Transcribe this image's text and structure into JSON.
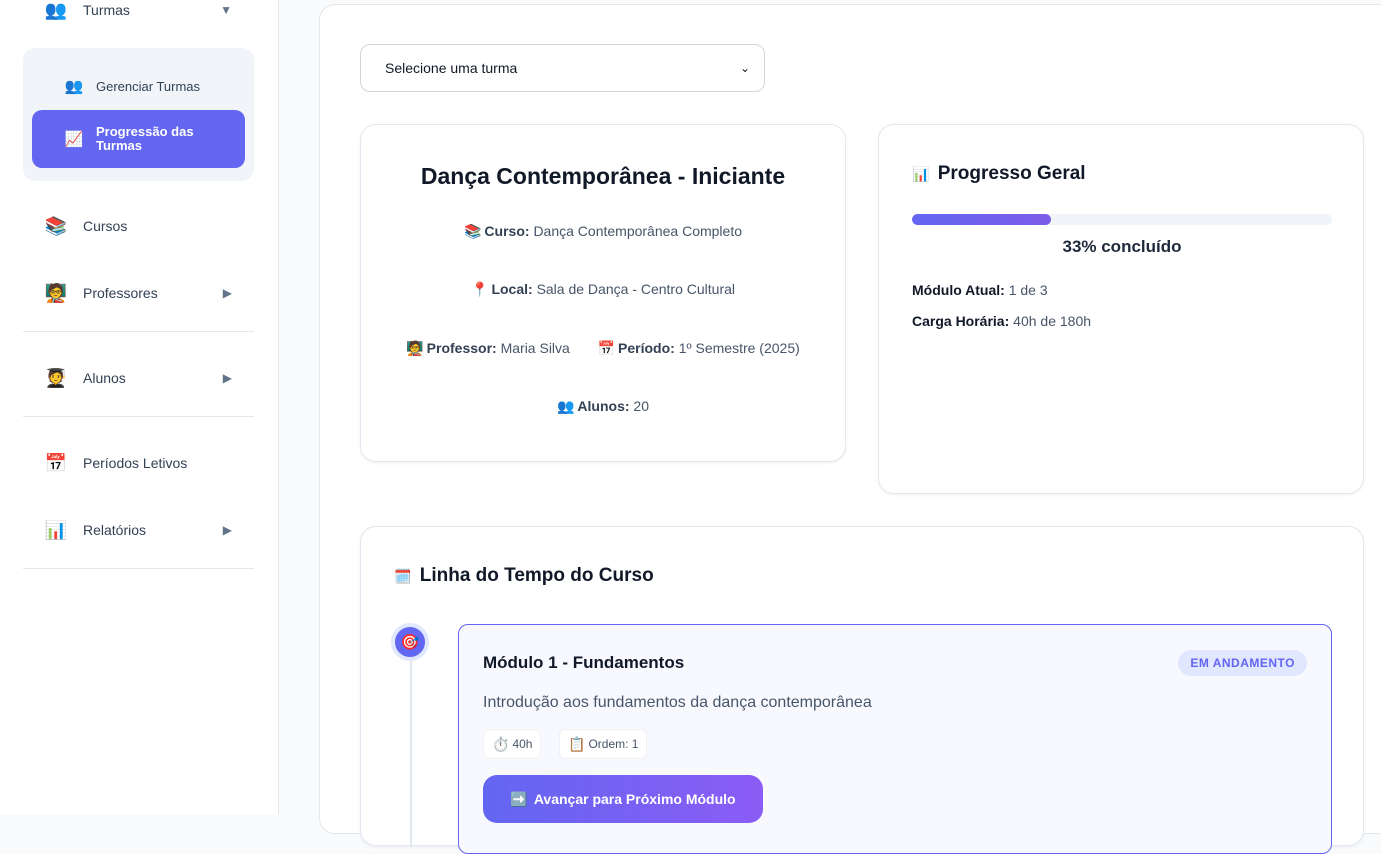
{
  "sidebar": {
    "turmas": {
      "label": "Turmas",
      "icon": "people-icon"
    },
    "submenu": [
      {
        "label": "Gerenciar Turmas",
        "icon": "people-icon"
      },
      {
        "label": "Progressão das Turmas",
        "icon": "chart-increasing-icon",
        "active": true
      }
    ],
    "items": [
      {
        "label": "Cursos",
        "icon": "books-icon"
      },
      {
        "label": "Professores",
        "icon": "teacher-icon"
      },
      {
        "label": "Alunos",
        "icon": "student-icon"
      },
      {
        "label": "Períodos Letivos",
        "icon": "calendar-icon"
      },
      {
        "label": "Relatórios",
        "icon": "bar-chart-icon"
      }
    ],
    "accent_color": "#6366f1"
  },
  "select": {
    "value": "Selecione uma turma"
  },
  "turma": {
    "title": "Dança Contemporânea - Iniciante",
    "curso_label": "Curso:",
    "curso_value": "Dança Contemporânea Completo",
    "local_label": "Local:",
    "local_value": "Sala de Dança - Centro Cultural",
    "professor_label": "Professor:",
    "professor_value": "Maria Silva",
    "periodo_label": "Período:",
    "periodo_value": "1º Semestre (2025)",
    "alunos_label": "Alunos:",
    "alunos_value": "20"
  },
  "progresso": {
    "title": "Progresso Geral",
    "percent": 33,
    "percent_text": "33% concluído",
    "modulo_label": "Módulo Atual:",
    "modulo_value": "1 de 3",
    "carga_label": "Carga Horária:",
    "carga_value": "40h de 180h"
  },
  "timeline": {
    "title": "Linha do Tempo do Curso",
    "module": {
      "title": "Módulo 1 - Fundamentos",
      "status": "EM ANDAMENTO",
      "description": "Introdução aos fundamentos da dança contemporânea",
      "hours": "40h",
      "order": "Ordem: 1",
      "button_label": "Avançar para Próximo Módulo"
    }
  }
}
